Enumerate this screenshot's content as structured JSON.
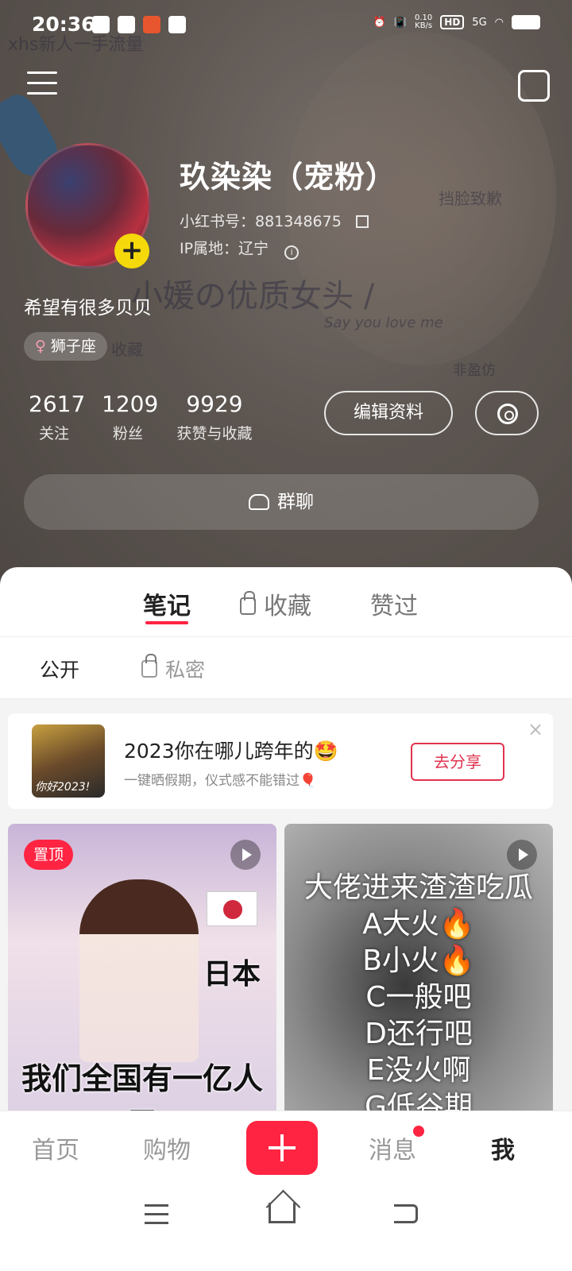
{
  "status_bar": {
    "time": "20:36",
    "net_speed_value": "0.10",
    "net_speed_unit": "KB/s",
    "hd": "HD",
    "signal": "5G"
  },
  "header_watermarks": [
    "xhs新人一手流量",
    "挡脸致歉",
    "小媛の优质女头 /",
    "Say you love me",
    "非盈仿",
    "收藏"
  ],
  "profile": {
    "nickname": "玖染染（宠粉）",
    "red_id": "小红书号：881348675",
    "ip": "IP属地：辽宁",
    "bio": "希望有很多贝贝",
    "zodiac_symbol": "♀",
    "zodiac": "狮子座"
  },
  "stats": [
    {
      "value": "2617",
      "label": "关注"
    },
    {
      "value": "1209",
      "label": "粉丝"
    },
    {
      "value": "9929",
      "label": "获赞与收藏"
    }
  ],
  "buttons": {
    "edit_profile": "编辑资料",
    "group_chat": "群聊"
  },
  "tabs": [
    "笔记",
    "收藏",
    "赞过"
  ],
  "subtabs": [
    "公开",
    "私密"
  ],
  "banner": {
    "title": "2023你在哪儿跨年的🤩",
    "subtitle": "一键晒假期，仪式感不能错过🎈",
    "thumb_text": "你好2023!",
    "cta": "去分享",
    "close": "×"
  },
  "cards": {
    "left": {
      "pin_label": "置顶",
      "caption": "我们全国有一亿人口",
      "side_text": "日本"
    },
    "right": {
      "lines": [
        "大佬进来渣渣吃瓜",
        "A大火🔥",
        "B小火🔥",
        "C一般吧",
        "D还行吧",
        "E没火啊",
        "G低谷期"
      ]
    }
  },
  "bottom_nav": [
    "首页",
    "购物",
    "消息",
    "我"
  ],
  "colors": {
    "brand_red": "#ff2442",
    "avatar_badge": "#f5d90a"
  }
}
